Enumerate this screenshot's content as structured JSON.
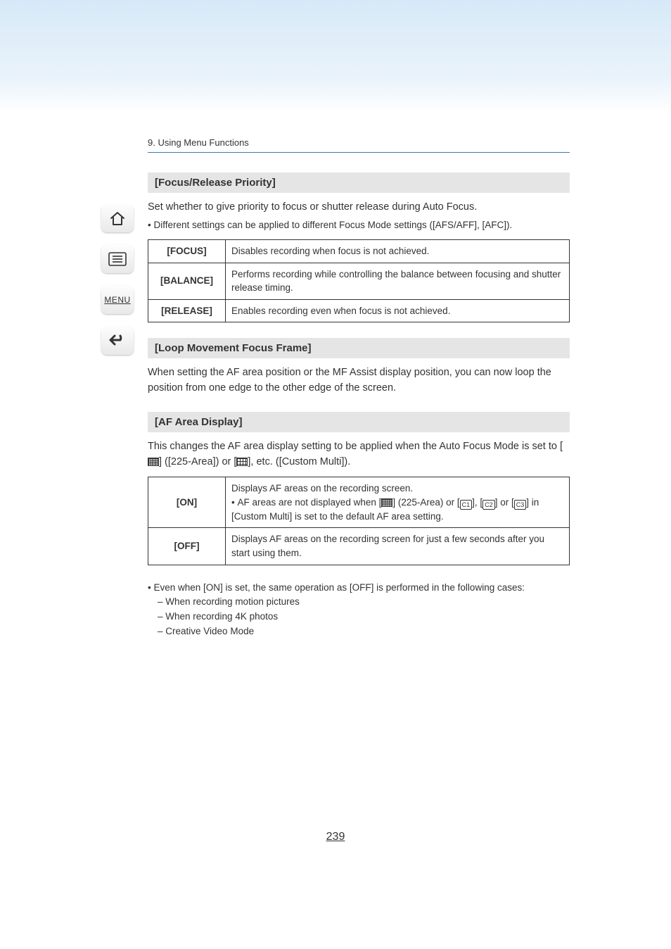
{
  "breadcrumb": "9. Using Menu Functions",
  "sections": {
    "s1": {
      "title": "[Focus/Release Priority]",
      "intro": "Set whether to give priority to focus or shutter release during Auto Focus.",
      "note": "Different settings can be applied to different Focus Mode settings ([AFS/AFF], [AFC]).",
      "rows": {
        "r0": {
          "label": "[FOCUS]",
          "desc": "Disables recording when focus is not achieved."
        },
        "r1": {
          "label": "[BALANCE]",
          "desc": "Performs recording while controlling the balance between focusing and shutter release timing."
        },
        "r2": {
          "label": "[RELEASE]",
          "desc": "Enables recording even when focus is not achieved."
        }
      }
    },
    "s2": {
      "title": "[Loop Movement Focus Frame]",
      "intro": "When setting the AF area position or the MF Assist display position, you can now loop the position from one edge to the other edge of the screen."
    },
    "s3": {
      "title": "[AF Area Display]",
      "intro_a": "This changes the AF area display setting to be applied when the Auto Focus Mode is set to [",
      "intro_b": "] ([225-Area]) or [",
      "intro_c": "], etc. ([Custom Multi]).",
      "rows": {
        "r0": {
          "label": "[ON]",
          "line1": "Displays AF areas on the recording screen.",
          "bullet_a": "AF areas are not displayed when [",
          "bullet_b": "] (225-Area) or [",
          "bullet_c": "], [",
          "bullet_d": "] or [",
          "bullet_e": "] in [Custom Multi] is set to the default AF area setting.",
          "c1": "C1",
          "c2": "C2",
          "c3": "C3"
        },
        "r1": {
          "label": "[OFF]",
          "desc": "Displays AF areas on the recording screen for just a few seconds after you start using them."
        }
      },
      "notes": {
        "n0": "Even when [ON] is set, the same operation as [OFF] is performed in the following cases:",
        "n1": "When recording motion pictures",
        "n2": "When recording 4K photos",
        "n3": "Creative Video Mode"
      }
    }
  },
  "sidebar": {
    "menu": "MENU"
  },
  "page_number": "239"
}
